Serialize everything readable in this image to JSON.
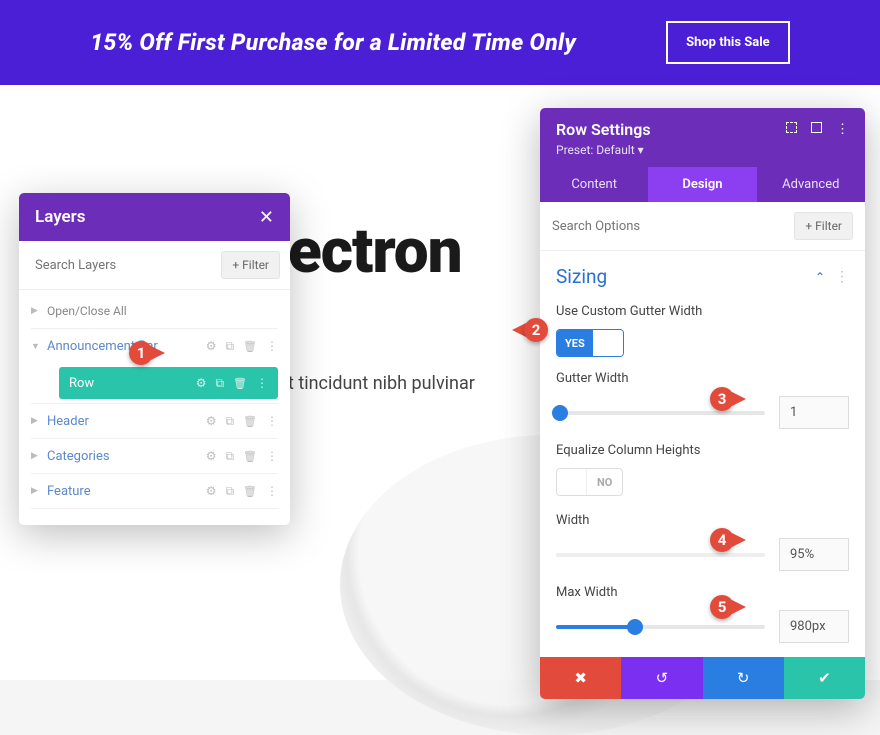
{
  "promo": {
    "text": "15% Off First Purchase for a Limited Time Only",
    "button": "Shop this Sale"
  },
  "background": {
    "heading_fragment": "ectron",
    "sub_fragment": "t tincidunt nibh pulvinar"
  },
  "layers_panel": {
    "title": "Layers",
    "search_placeholder": "Search Layers",
    "filter_label": "+ Filter",
    "open_close": "Open/Close All",
    "items": [
      {
        "label": "Announcement Bar"
      },
      {
        "label": "Row",
        "active": true
      },
      {
        "label": "Header"
      },
      {
        "label": "Categories"
      },
      {
        "label": "Feature"
      }
    ]
  },
  "settings_panel": {
    "title": "Row Settings",
    "preset": "Preset: Default ▾",
    "tabs": {
      "content": "Content",
      "design": "Design",
      "advanced": "Advanced"
    },
    "search_placeholder": "Search Options",
    "filter_label": "+ Filter",
    "section": "Sizing",
    "fields": {
      "use_custom_gutter": {
        "label": "Use Custom Gutter Width",
        "value": "YES"
      },
      "gutter_width": {
        "label": "Gutter Width",
        "value": "1"
      },
      "equalize": {
        "label": "Equalize Column Heights",
        "value": "NO"
      },
      "width": {
        "label": "Width",
        "value": "95%"
      },
      "max_width": {
        "label": "Max Width",
        "value": "980px"
      }
    }
  },
  "callouts": {
    "c1": "1",
    "c2": "2",
    "c3": "3",
    "c4": "4",
    "c5": "5"
  }
}
